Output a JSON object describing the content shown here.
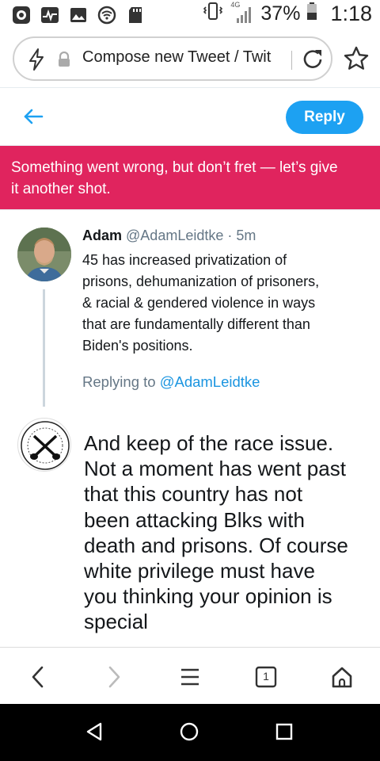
{
  "status_bar": {
    "left_icons": [
      "app-icon",
      "pulse-icon",
      "image-icon",
      "hotspot-icon",
      "sd-card-icon"
    ],
    "network_label": "4G",
    "battery_percent": "37%",
    "time": "1:18"
  },
  "browser": {
    "url_text": "Compose new Tweet / Twit",
    "icons": [
      "bolt-icon",
      "lock-icon",
      "reload-icon",
      "star-icon"
    ]
  },
  "header": {
    "reply_label": "Reply"
  },
  "error_banner": {
    "line1": "Something went wrong, but don’t fret — let’s give",
    "line2": "it another shot."
  },
  "reply_tweet": {
    "name": "Adam",
    "handle": "@AdamLeidtke",
    "separator": "·",
    "time": "5m",
    "lines": [
      "45 has increased privatization of",
      "prisons, dehumanization of prisoners,",
      "& racial & gendered violence in ways",
      "that are fundamentally different than",
      "Biden's positions."
    ],
    "replying_prefix": "Replying to ",
    "replying_mention": "@AdamLeidtke"
  },
  "compose": {
    "lines": [
      "And keep of the race issue.",
      "Not a moment has went past",
      "that this country has not",
      "been attacking Blks with",
      "death and prisons. Of course",
      "white privilege must have",
      "you thinking your opinion is",
      "special"
    ]
  },
  "toolbar": {
    "tab_count": "1"
  },
  "colors": {
    "accent": "#1da1f2",
    "error": "#e0245e",
    "muted": "#657786"
  }
}
